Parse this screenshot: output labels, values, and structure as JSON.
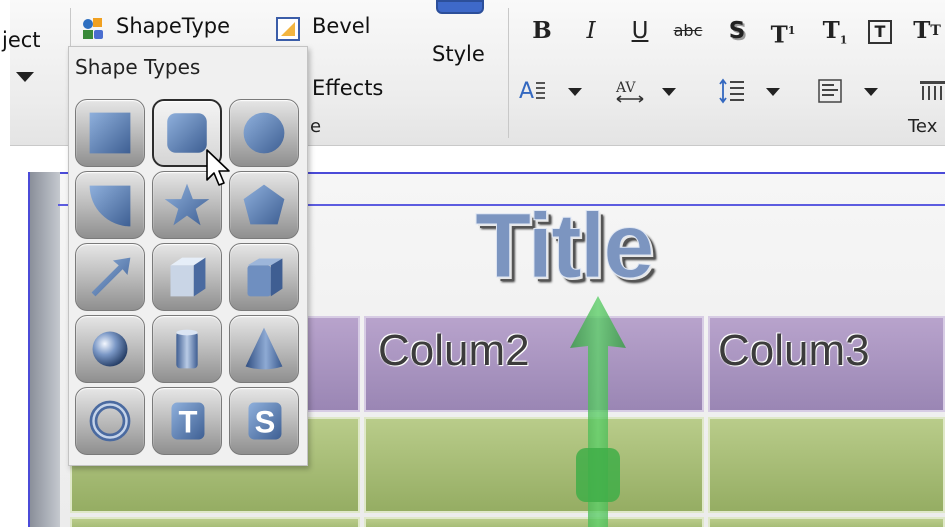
{
  "ribbon": {
    "object_label": "ject",
    "shape_type_label": "ShapeType",
    "bevel_label": "Bevel",
    "effects_label": "Effects",
    "style_label": "Style",
    "group_label_partial": "e",
    "text_group_label": "Tex",
    "format_buttons": {
      "bold": "B",
      "italic": "I",
      "underline": "U",
      "strike": "abc",
      "shadow": "S",
      "superscript": "T",
      "subscript": "T"
    }
  },
  "shape_panel": {
    "title": "Shape Types",
    "shapes": [
      "square-shape-icon",
      "rounded-square-shape-icon",
      "circle-shape-icon",
      "quarter-circle-shape-icon",
      "star-shape-icon",
      "pentagon-shape-icon",
      "arrow-shape-icon",
      "cube-shape-icon",
      "rounded-cube-shape-icon",
      "sphere-shape-icon",
      "cylinder-shape-icon",
      "cone-shape-icon",
      "torus-shape-icon",
      "text-t-shape-icon",
      "text-s-shape-icon"
    ],
    "letter_t": "T",
    "letter_s": "S"
  },
  "slide": {
    "title": "Title",
    "columns": [
      "Colum2",
      "Colum3"
    ]
  },
  "colors": {
    "header_cell": "#a592be",
    "body_cell": "#a8bd78",
    "selection_line": "#4b4bd8",
    "shape_blue": "#5878a8"
  }
}
